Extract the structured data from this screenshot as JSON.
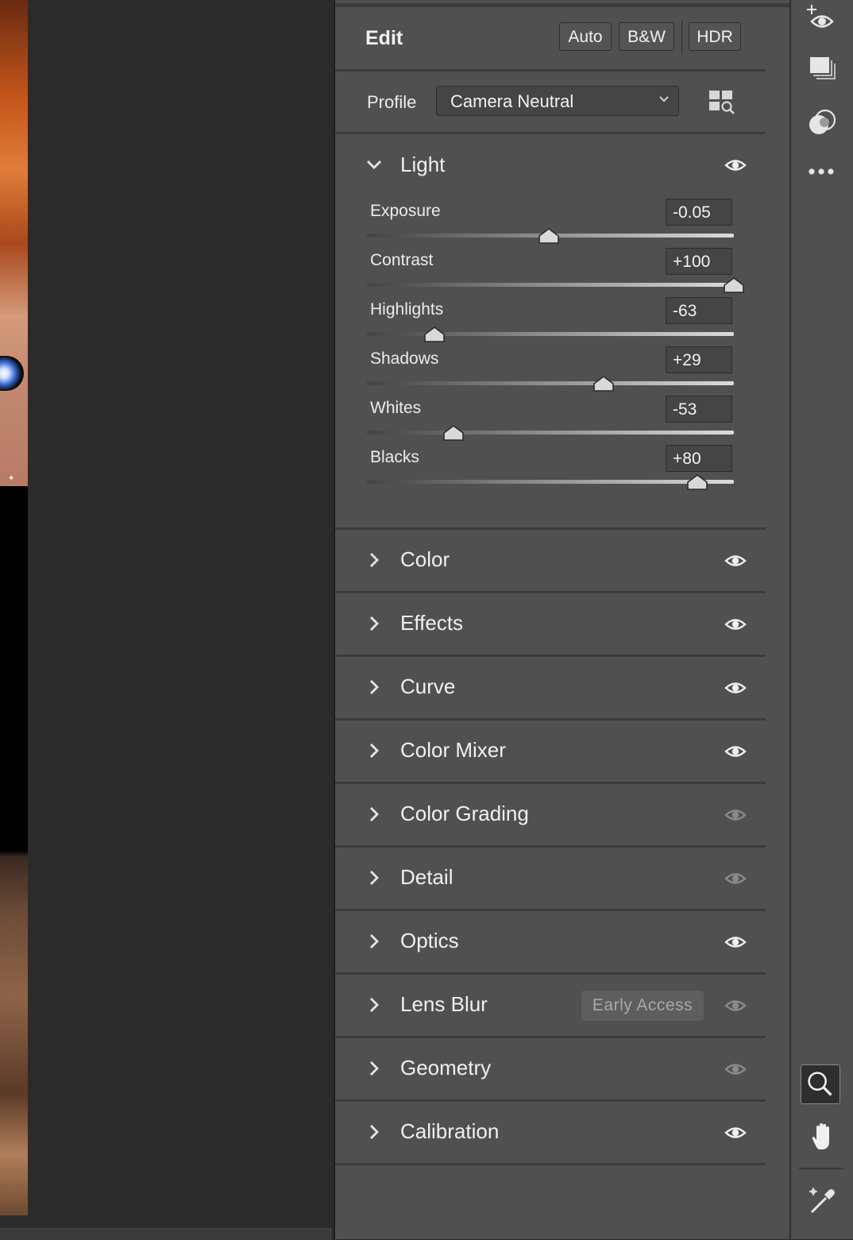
{
  "header": {
    "title": "Edit",
    "buttons": [
      {
        "label": "Auto"
      },
      {
        "label": "B&W"
      },
      {
        "label": "HDR"
      }
    ]
  },
  "profile": {
    "label": "Profile",
    "value": "Camera Neutral"
  },
  "light": {
    "title": "Light",
    "expanded": true,
    "sliders": [
      {
        "label": "Exposure",
        "value": "-0.05",
        "min": -5,
        "max": 5,
        "numeric": -0.05
      },
      {
        "label": "Contrast",
        "value": "+100",
        "min": -100,
        "max": 100,
        "numeric": 100
      },
      {
        "label": "Highlights",
        "value": "-63",
        "min": -100,
        "max": 100,
        "numeric": -63
      },
      {
        "label": "Shadows",
        "value": "+29",
        "min": -100,
        "max": 100,
        "numeric": 29
      },
      {
        "label": "Whites",
        "value": "-53",
        "min": -100,
        "max": 100,
        "numeric": -53
      },
      {
        "label": "Blacks",
        "value": "+80",
        "min": -100,
        "max": 100,
        "numeric": 80
      }
    ]
  },
  "sections": [
    {
      "title": "Color",
      "eye_active": true
    },
    {
      "title": "Effects",
      "eye_active": true
    },
    {
      "title": "Curve",
      "eye_active": true
    },
    {
      "title": "Color Mixer",
      "eye_active": true
    },
    {
      "title": "Color Grading",
      "eye_active": false
    },
    {
      "title": "Detail",
      "eye_active": false
    },
    {
      "title": "Optics",
      "eye_active": true
    },
    {
      "title": "Lens Blur",
      "eye_active": false,
      "badge": "Early Access"
    },
    {
      "title": "Geometry",
      "eye_active": false
    },
    {
      "title": "Calibration",
      "eye_active": true
    }
  ],
  "toolbar": {
    "tools": [
      "add-preview-icon",
      "snapshots-icon",
      "presets-icon",
      "more-icon"
    ],
    "bottom_tools": [
      "zoom-icon",
      "hand-icon",
      "color-sampler-icon"
    ],
    "active_tool": "zoom-icon"
  },
  "colors": {
    "panel_bg": "#505050",
    "divider": "#3c3c3c",
    "eye_active": "#f0f0f0",
    "eye_inactive": "#8a8a8a"
  }
}
